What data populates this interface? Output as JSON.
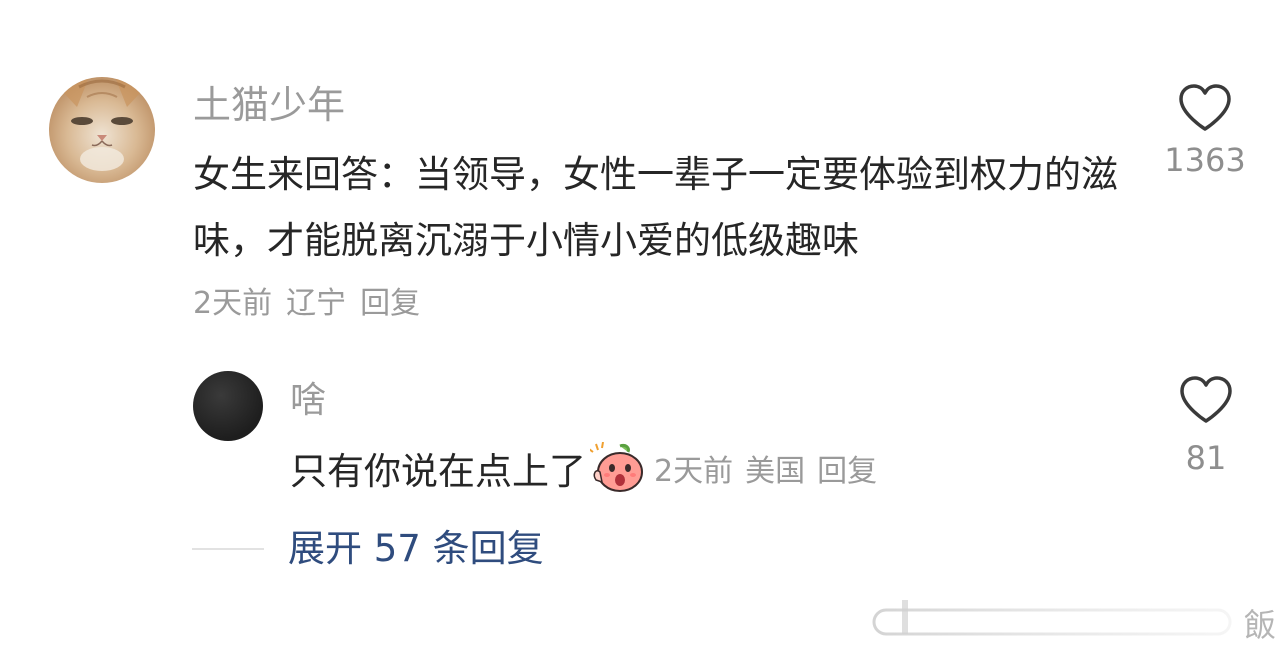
{
  "comment": {
    "username": "土猫少年",
    "text": "女生来回答：当领导，女性一辈子一定要体验到权力的滋味，才能脱离沉溺于小情小爱的低级趣味",
    "time": "2天前",
    "location": "辽宁",
    "reply_label": "回复",
    "like_count": "1363",
    "avatar_icon": "cat-face-avatar"
  },
  "reply": {
    "username": "啥",
    "text": "只有你说在点上了",
    "emoji_icon": "shocked-peach-emoji",
    "time": "2天前",
    "location": "美国",
    "reply_label": "回复",
    "like_count": "81"
  },
  "expand": {
    "label": "展开 57 条回复"
  },
  "watermark": {
    "text": "飯"
  },
  "colors": {
    "meta_gray": "#9a9a9a",
    "text_dark": "#262626",
    "link_blue": "#2f4c7e"
  }
}
